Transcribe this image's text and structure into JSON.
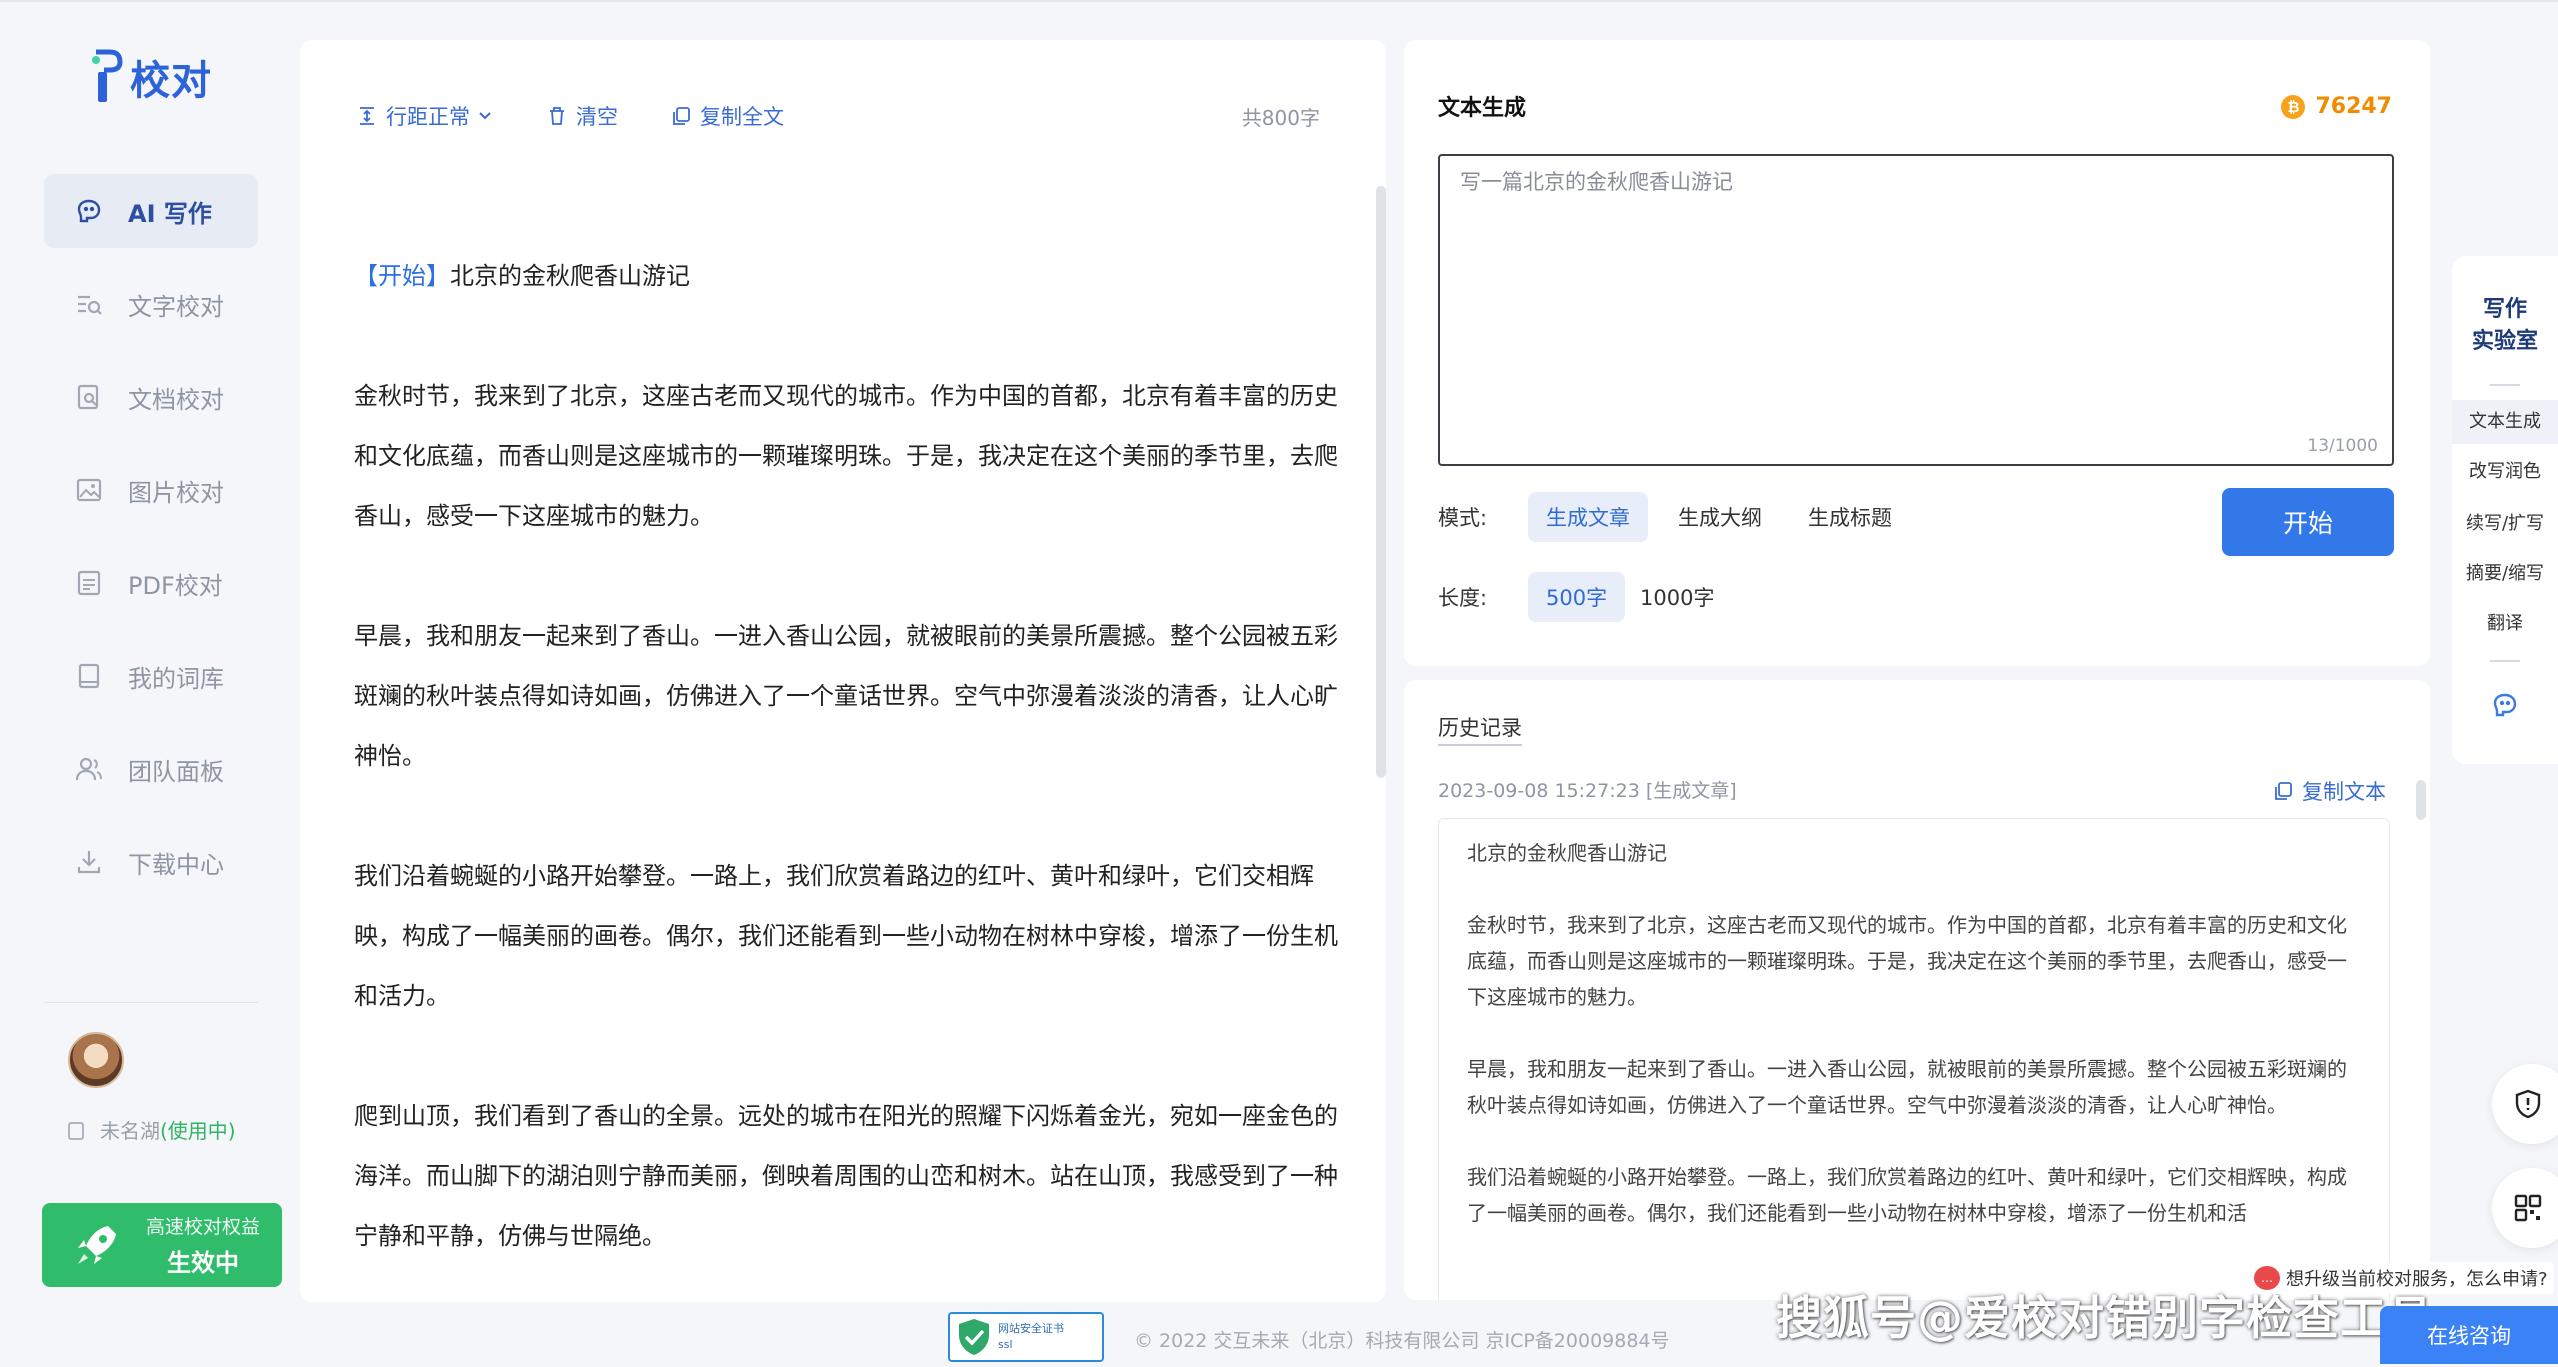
{
  "app": {
    "logo_text": "校对"
  },
  "sidebar": {
    "items": [
      {
        "label": "AI 写作",
        "icon": "brain-icon",
        "active": true
      },
      {
        "label": "文字校对",
        "icon": "text-search-icon",
        "active": false
      },
      {
        "label": "文档校对",
        "icon": "document-search-icon",
        "active": false
      },
      {
        "label": "图片校对",
        "icon": "image-icon",
        "active": false
      },
      {
        "label": "PDF校对",
        "icon": "pdf-icon",
        "active": false
      },
      {
        "label": "我的词库",
        "icon": "book-icon",
        "active": false
      },
      {
        "label": "团队面板",
        "icon": "team-icon",
        "active": false
      },
      {
        "label": "下载中心",
        "icon": "download-icon",
        "active": false
      }
    ],
    "user": {
      "name": "未名湖",
      "status": "(使用中)"
    },
    "promo": {
      "line1": "高速校对权益",
      "line2": "生效中"
    }
  },
  "editor": {
    "toolbar": {
      "line_spacing": "行距正常",
      "clear": "清空",
      "copy_all": "复制全文",
      "word_count": "共800字"
    },
    "title_tag": "【开始】",
    "title": "北京的金秋爬香山游记",
    "paragraphs": [
      "金秋时节，我来到了北京，这座古老而又现代的城市。作为中国的首都，北京有着丰富的历史和文化底蕴，而香山则是这座城市的一颗璀璨明珠。于是，我决定在这个美丽的季节里，去爬香山，感受一下这座城市的魅力。",
      "早晨，我和朋友一起来到了香山。一进入香山公园，就被眼前的美景所震撼。整个公园被五彩斑斓的秋叶装点得如诗如画，仿佛进入了一个童话世界。空气中弥漫着淡淡的清香，让人心旷神怡。",
      "我们沿着蜿蜒的小路开始攀登。一路上，我们欣赏着路边的红叶、黄叶和绿叶，它们交相辉映，构成了一幅美丽的画卷。偶尔，我们还能看到一些小动物在树林中穿梭，增添了一份生机和活力。",
      "爬到山顶，我们看到了香山的全景。远处的城市在阳光的照耀下闪烁着金光，宛如一座金色的海洋。而山脚下的湖泊则宁静而美丽，倒映着周围的山峦和树木。站在山顶，我感受到了一种宁静和平静，仿佛与世隔绝。"
    ]
  },
  "generator": {
    "title": "文本生成",
    "coins": "76247",
    "prompt_value": "写一篇北京的金秋爬香山游记",
    "prompt_count": "13/1000",
    "mode_label": "模式:",
    "modes": [
      "生成文章",
      "生成大纲",
      "生成标题"
    ],
    "length_label": "长度:",
    "lengths": [
      "500字",
      "1000字"
    ],
    "start_label": "开始"
  },
  "history": {
    "title": "历史记录",
    "meta": "2023-09-08 15:27:23 [生成文章]",
    "copy_label": "复制文本",
    "heading": "北京的金秋爬香山游记",
    "paragraphs": [
      "金秋时节，我来到了北京，这座古老而又现代的城市。作为中国的首都，北京有着丰富的历史和文化底蕴，而香山则是这座城市的一颗璀璨明珠。于是，我决定在这个美丽的季节里，去爬香山，感受一下这座城市的魅力。",
      "早晨，我和朋友一起来到了香山。一进入香山公园，就被眼前的美景所震撼。整个公园被五彩斑斓的秋叶装点得如诗如画，仿佛进入了一个童话世界。空气中弥漫着淡淡的清香，让人心旷神怡。",
      "我们沿着蜿蜒的小路开始攀登。一路上，我们欣赏着路边的红叶、黄叶和绿叶，它们交相辉映，构成了一幅美丽的画卷。偶尔，我们还能看到一些小动物在树林中穿梭，增添了一份生机和活"
    ]
  },
  "lab": {
    "title_line1": "写作",
    "title_line2": "实验室",
    "items": [
      "文本生成",
      "改写润色",
      "续写/扩写",
      "摘要/缩写",
      "翻译"
    ]
  },
  "footer": {
    "ssl_line1": "网站安全证书",
    "ssl_line2": "ssl",
    "copyright": "© 2022 交互未来（北京）科技有限公司 京ICP备20009884号",
    "upgrade_tip": "想升级当前校对服务，怎么申请?",
    "consult": "在线咨询",
    "watermark": "搜狐号@爱校对错别字检查工具"
  },
  "colors": {
    "accent": "#3278e8",
    "brand": "#2c63d9",
    "promo": "#2fbd6b",
    "coin": "#f08c00"
  }
}
